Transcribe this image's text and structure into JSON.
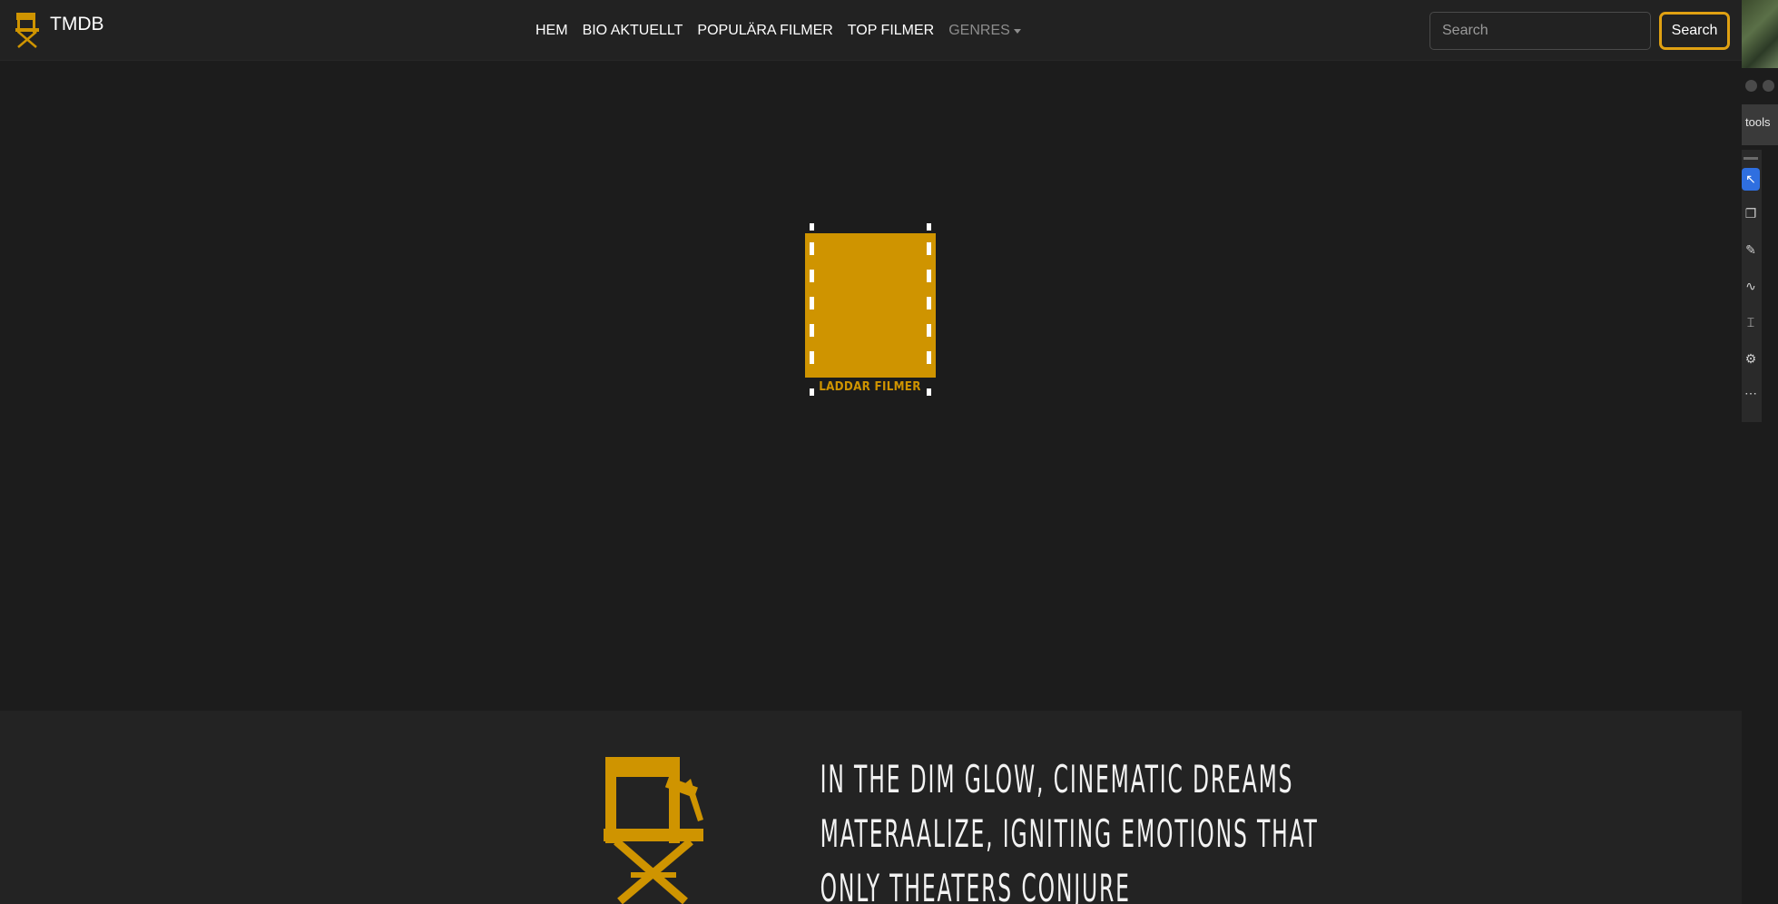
{
  "brand": {
    "name": "TMDB",
    "icon": "director-chair-icon"
  },
  "nav": {
    "items": [
      {
        "label": "HEM"
      },
      {
        "label": "BIO AKTUELLT"
      },
      {
        "label": "POPULÄRA FILMER"
      },
      {
        "label": "TOP FILMER"
      }
    ],
    "genres": {
      "label": "GENRES"
    }
  },
  "search": {
    "placeholder": "Search",
    "button_label": "Search"
  },
  "loader": {
    "text": "LADDAR FILMER",
    "icon": "film-reel-icon"
  },
  "footer": {
    "quote_lines": [
      "IN THE DIM GLOW, CINEMATIC DREAMS",
      "MATERAALIZE, IGNITING EMOTIONS THAT",
      "ONLY THEATERS CONJURE"
    ],
    "icon": "director-chair-icon"
  },
  "side_panel": {
    "tools_label": "tools",
    "tools": [
      "pointer-icon",
      "note-icon",
      "pencil-icon",
      "ink-icon",
      "text-select-icon",
      "stamp-icon",
      "more-icon"
    ]
  },
  "colors": {
    "accent": "#cf9400",
    "button_border": "#e0a112",
    "background": "#1c1c1c",
    "navbar": "#222222",
    "footer": "#232323"
  }
}
